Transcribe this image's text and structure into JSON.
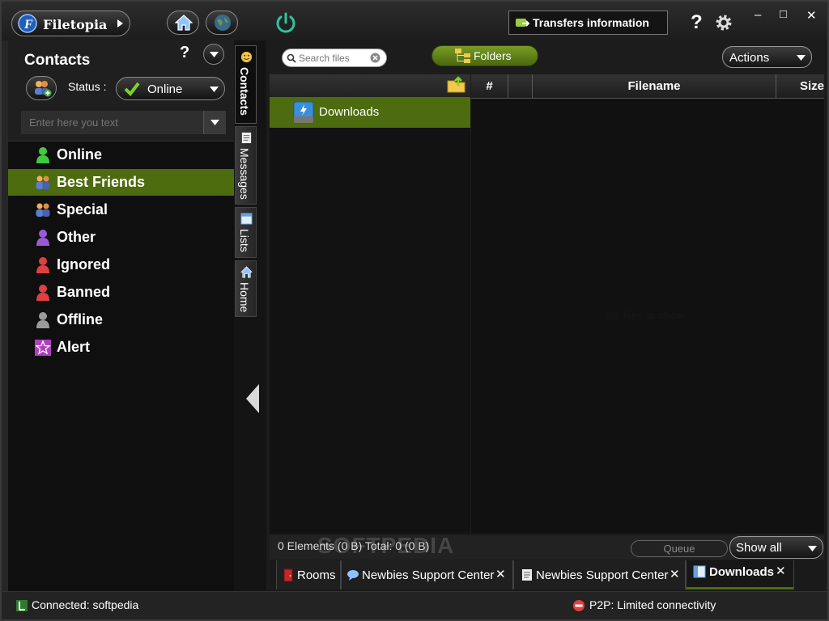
{
  "app": {
    "name": "Filetopia"
  },
  "header": {
    "transfers_label": "Transfers information",
    "help_glyph": "?",
    "window_buttons": {
      "minimize": "–",
      "maximize": "□",
      "close": "✕"
    }
  },
  "contacts": {
    "title": "Contacts",
    "help_glyph": "?",
    "status_label": "Status :",
    "status_value": "Online",
    "filter_placeholder": "Enter here you text",
    "groups": [
      {
        "label": "Online",
        "icon": "user-green-icon",
        "color": "#3fcb3f"
      },
      {
        "label": "Best Friends",
        "icon": "users-group-icon",
        "color": "#e0a040",
        "selected": true
      },
      {
        "label": "Special",
        "icon": "users-group-icon",
        "color": "#e0a040"
      },
      {
        "label": "Other",
        "icon": "user-purple-icon",
        "color": "#9b59d6"
      },
      {
        "label": "Ignored",
        "icon": "user-red-icon",
        "color": "#e04040"
      },
      {
        "label": "Banned",
        "icon": "user-red-icon",
        "color": "#e04040"
      },
      {
        "label": "Offline",
        "icon": "user-gray-icon",
        "color": "#9a9a9a"
      },
      {
        "label": "Alert",
        "icon": "star-alert-icon",
        "color": "#b040c0"
      }
    ]
  },
  "vertical_tabs": [
    {
      "label": "Contacts",
      "icon": "smiley-icon",
      "active": true
    },
    {
      "label": "Messages",
      "icon": "document-icon"
    },
    {
      "label": "Lists",
      "icon": "list-window-icon"
    },
    {
      "label": "Home",
      "icon": "home-icon"
    }
  ],
  "main": {
    "search_placeholder": "Search files",
    "folders_label": "Folders",
    "actions_label": "Actions",
    "folders": [
      {
        "label": "Downloads",
        "icon": "drive-icon"
      }
    ],
    "columns": [
      "#",
      "",
      "Filename",
      "Size"
    ],
    "empty_text": "No files to show",
    "footer": {
      "elements_text": "0  Elements (0 B)  Total: 0 (0 B)",
      "queue_label": "Queue",
      "filter_value": "Show all"
    },
    "tabs": [
      {
        "label": "Rooms",
        "icon": "room-door-icon"
      },
      {
        "label": "Newbies Support Center",
        "icon": "chat-icon",
        "close": "✕"
      },
      {
        "label": "Newbies Support Center",
        "icon": "document-icon",
        "close": "✕"
      },
      {
        "label": "Downloads",
        "icon": "window-icon",
        "close": "✕",
        "active": true
      }
    ]
  },
  "statusbar": {
    "connection": "Connected: softpedia",
    "p2p": "P2P: Limited connectivity"
  },
  "watermark": "SOFTPEDIA",
  "colors": {
    "accent": "#4d6b0f",
    "power": "#2ec4a0"
  }
}
